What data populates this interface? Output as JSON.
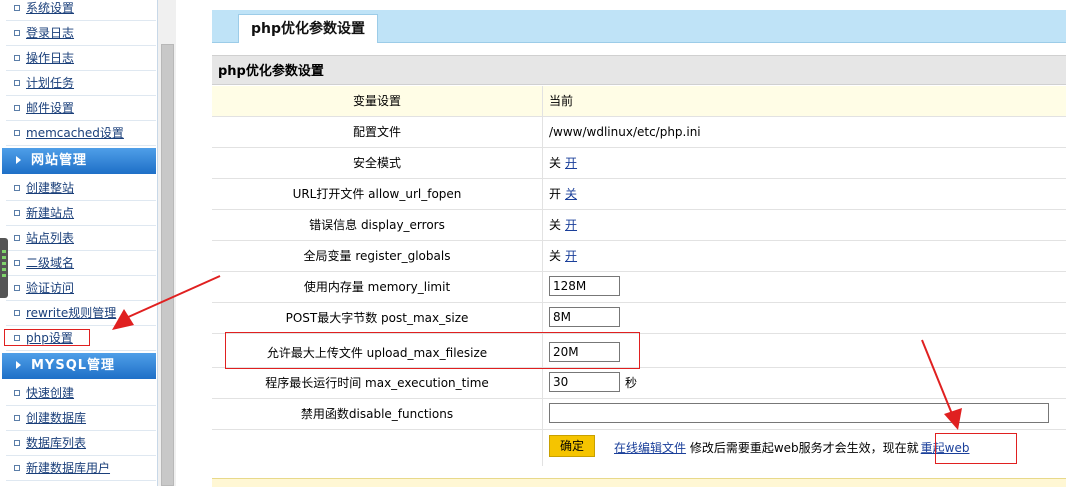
{
  "sidebar": {
    "items_top": [
      "系统设置",
      "登录日志",
      "操作日志",
      "计划任务",
      "邮件设置",
      "memcached设置"
    ],
    "section_site": "网站管理",
    "items_site": [
      "创建整站",
      "新建站点",
      "站点列表",
      "二级域名",
      "验证访问",
      "rewrite规则管理",
      "php设置"
    ],
    "section_mysql": "MYSQL管理",
    "items_mysql": [
      "快速创建",
      "创建数据库",
      "数据库列表",
      "新建数据库用户"
    ]
  },
  "page": {
    "tab_title": "php优化参数设置",
    "table_caption": "php优化参数设置"
  },
  "table": {
    "header": {
      "name": "变量设置",
      "value": "当前"
    },
    "config_file": {
      "name": "配置文件",
      "value": "/www/wdlinux/etc/php.ini"
    },
    "safe_mode": {
      "name": "安全模式",
      "state": "关",
      "toggle": "开"
    },
    "allow_url_fopen": {
      "name": "URL打开文件 allow_url_fopen",
      "state": "开",
      "toggle": "关"
    },
    "display_errors": {
      "name": "错误信息 display_errors",
      "state": "关",
      "toggle": "开"
    },
    "register_globals": {
      "name": "全局变量 register_globals",
      "state": "关",
      "toggle": "开"
    },
    "memory_limit": {
      "name": "使用内存量 memory_limit",
      "value": "128M"
    },
    "post_max_size": {
      "name": "POST最大字节数 post_max_size",
      "value": "8M"
    },
    "upload_max_filesize": {
      "name": "允许最大上传文件 upload_max_filesize",
      "value": "20M"
    },
    "max_execution_time": {
      "name": "程序最长运行时间 max_execution_time",
      "value": "30",
      "unit": "秒"
    },
    "disable_functions": {
      "name": "禁用函数disable_functions",
      "value": ""
    }
  },
  "footer": {
    "confirm": "确定",
    "online_edit": "在线编辑文件",
    "notice": "修改后需要重起web服务才会生效，现在就",
    "restart": "重起web"
  },
  "colors": {
    "sidebar_header": "#1e6fc7",
    "title_bar": "#bfe3f7",
    "row_highlight": "#fffde6",
    "confirm_button": "#f5c400",
    "annotation": "#e02020"
  }
}
